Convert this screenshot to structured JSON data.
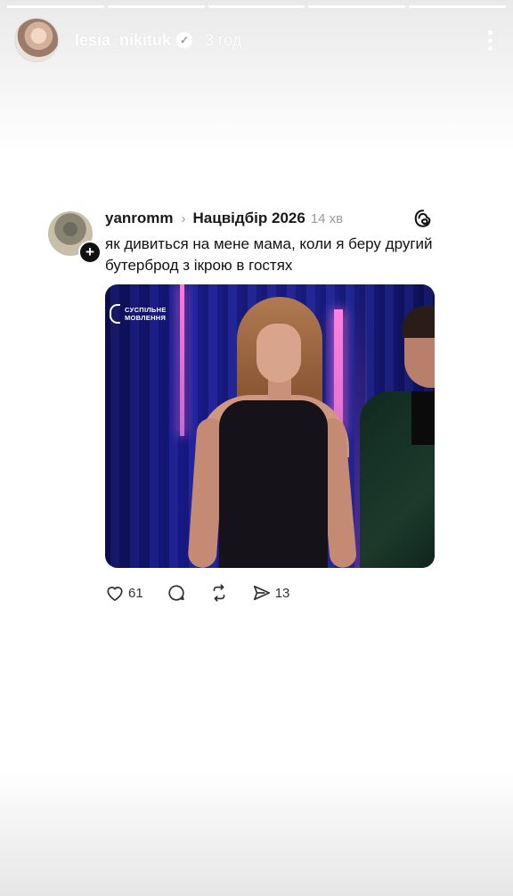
{
  "story": {
    "username": "lesia_nikituk",
    "time": "3 год",
    "progress_segments": 5
  },
  "post": {
    "author": "yanromm",
    "topic": "Нацвідбір 2026",
    "time": "14 хв",
    "text": "як дивиться на мене мама, коли я беру другий бутерброд з ікрою в гостях",
    "image_watermark": "СУСПІЛЬНЕ\nМОВЛЕННЯ",
    "likes": "61",
    "shares": "13"
  },
  "colors": {
    "accent_text": "#111111",
    "muted_text": "#9b9b9b",
    "card_bg": "#ffffff"
  }
}
